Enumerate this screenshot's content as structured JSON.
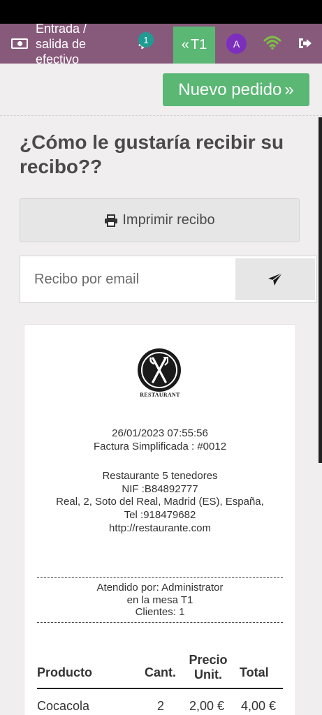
{
  "topbar": {
    "cash_label": "Entrada / salida de efectivo",
    "order_badge": "1",
    "table_label": "T1",
    "avatar_initial": "A"
  },
  "actions": {
    "new_order_label": "Nuevo pedido"
  },
  "receipt_screen": {
    "question": "¿Cómo le gustaría recibir su recibo??",
    "print_label": "Imprimir recibo",
    "email_placeholder": "Recibo por email"
  },
  "receipt": {
    "logo_text": "RESTAURANT",
    "datetime": "26/01/2023 07:55:56",
    "invoice": "Factura Simplificada : #0012",
    "company_name": "Restaurante 5 tenedores",
    "nif": "NIF :B84892777",
    "address": "Real, 2, Soto del Real, Madrid (ES), España,",
    "tel": "Tel :918479682",
    "website": "http://restaurante.com",
    "served_by": "Atendido por: Administrator",
    "table": "en la mesa T1",
    "clients": "Clientes: 1",
    "columns": {
      "product": "Producto",
      "qty": "Cant.",
      "price_line1": "Precio",
      "price_line2": "Unit.",
      "total": "Total"
    },
    "lines": [
      {
        "product": "Cocacola",
        "qty": "2",
        "price": "2,00 €",
        "total": "4,00 €"
      }
    ]
  },
  "colors": {
    "topbar": "#875a7b",
    "accent_green": "#5ab774",
    "badge": "#1f9b93",
    "avatar": "#7c2fbd"
  }
}
